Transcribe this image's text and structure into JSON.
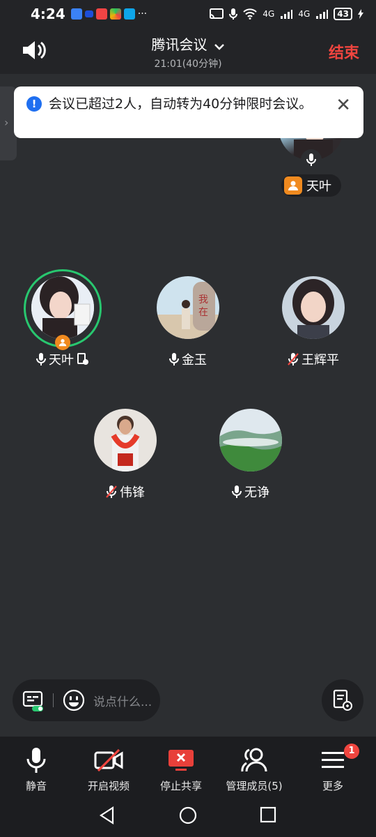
{
  "status_bar": {
    "time": "4:24",
    "battery": "43",
    "signal_1": "4G",
    "signal_2": "4G"
  },
  "header": {
    "title": "腾讯会议",
    "time": "21:01(40分钟)",
    "end_label": "结束"
  },
  "toast": {
    "message": "会议已超过2人，自动转为40分钟限时会议。"
  },
  "floating_tile": {
    "name": "天叶"
  },
  "participants": [
    {
      "name": "天叶",
      "mic": "on",
      "host": true,
      "speaking": true
    },
    {
      "name": "金玉",
      "mic": "on"
    },
    {
      "name": "王辉平",
      "mic": "off"
    },
    {
      "name": "伟锋",
      "mic": "off"
    },
    {
      "name": "无诤",
      "mic": "on"
    }
  ],
  "chat": {
    "placeholder": "说点什么..."
  },
  "toolbar": {
    "mute_label": "静音",
    "video_label": "开启视频",
    "share_label": "停止共享",
    "members_label": "管理成员(5)",
    "more_label": "更多",
    "more_badge": "1"
  },
  "colors": {
    "accent_red": "#f0453f",
    "speaking_ring": "#28c76f",
    "host_orange": "#f08a1f",
    "info_blue": "#1f6ff0"
  }
}
